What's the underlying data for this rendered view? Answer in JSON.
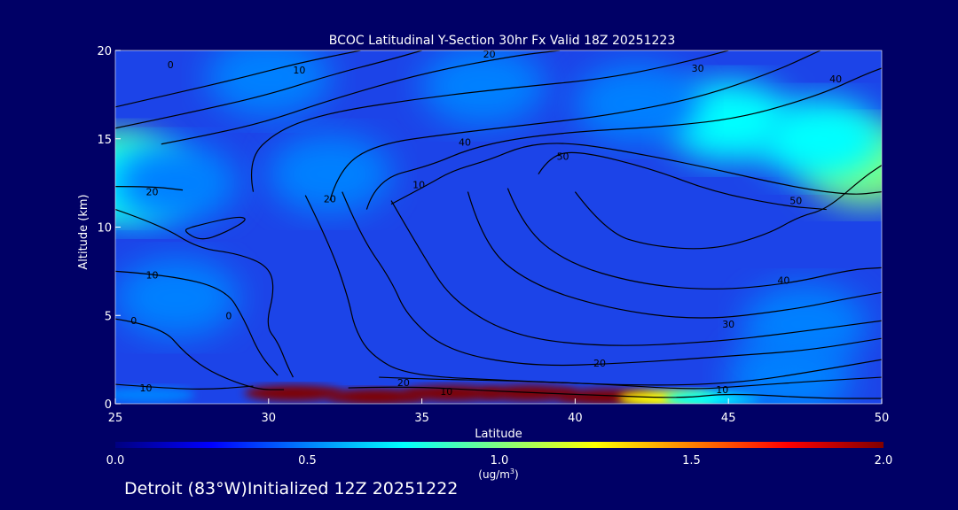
{
  "chart_data": {
    "type": "heatmap",
    "title": "BCOC Latitudinal Y-Section 30hr  Fx Valid 18Z 20251223",
    "xlabel": "Latitude",
    "ylabel": "Altitude (km)",
    "xlim": [
      25,
      50
    ],
    "ylim": [
      0,
      20
    ],
    "x_ticks": [
      "25",
      "30",
      "35",
      "40",
      "45",
      "50"
    ],
    "y_ticks": [
      "0",
      "5",
      "10",
      "15",
      "20"
    ],
    "colorbar": {
      "min": 0.0,
      "max": 2.0,
      "ticks": [
        "0.0",
        "0.5",
        "1.0",
        "1.5",
        "2.0"
      ],
      "unit_prefix": "(ug/m",
      "unit_sup": "3",
      "unit_suffix": ")",
      "colors": [
        "#000080",
        "#0000ff",
        "#0080ff",
        "#00ffff",
        "#80ff80",
        "#ffff00",
        "#ff8000",
        "#ff0000",
        "#800000"
      ]
    },
    "concentration_points": [
      {
        "lat": 25,
        "alt": 13,
        "value": 0.9
      },
      {
        "lat": 25.5,
        "alt": 12.5,
        "value": 0.75
      },
      {
        "lat": 49.5,
        "alt": 13.5,
        "value": 1.0
      },
      {
        "lat": 48,
        "alt": 15,
        "value": 0.8
      },
      {
        "lat": 45,
        "alt": 16,
        "value": 0.65
      },
      {
        "lat": 42,
        "alt": 17,
        "value": 0.5
      },
      {
        "lat": 37,
        "alt": 18,
        "value": 0.45
      },
      {
        "lat": 30,
        "alt": 18.5,
        "value": 0.45
      },
      {
        "lat": 27,
        "alt": 12.5,
        "value": 0.45
      },
      {
        "lat": 32,
        "alt": 13,
        "value": 0.4
      },
      {
        "lat": 30.8,
        "alt": 0.6,
        "value": 2.0
      },
      {
        "lat": 33.5,
        "alt": 0.4,
        "value": 1.9
      },
      {
        "lat": 36,
        "alt": 0.6,
        "value": 2.0
      },
      {
        "lat": 38.5,
        "alt": 0.6,
        "value": 2.0
      },
      {
        "lat": 41,
        "alt": 0.4,
        "value": 1.9
      },
      {
        "lat": 43,
        "alt": 0.3,
        "value": 1.2
      },
      {
        "lat": 44.5,
        "alt": 0.3,
        "value": 0.7
      },
      {
        "lat": 26,
        "alt": 0.5,
        "value": 0.5
      },
      {
        "lat": 47,
        "alt": 1.5,
        "value": 0.45
      },
      {
        "lat": 47.5,
        "alt": 4.5,
        "value": 0.45
      },
      {
        "lat": 27,
        "alt": 6,
        "value": 0.45
      }
    ],
    "contour_labels": [
      {
        "lat": 26.8,
        "alt": 19.2,
        "text": "0"
      },
      {
        "lat": 31.0,
        "alt": 18.9,
        "text": "10"
      },
      {
        "lat": 37.2,
        "alt": 19.8,
        "text": "20"
      },
      {
        "lat": 44.0,
        "alt": 19.0,
        "text": "30"
      },
      {
        "lat": 48.5,
        "alt": 18.4,
        "text": "40"
      },
      {
        "lat": 26.2,
        "alt": 12.0,
        "text": "20"
      },
      {
        "lat": 28.7,
        "alt": 5.0,
        "text": "0"
      },
      {
        "lat": 34.9,
        "alt": 12.4,
        "text": "10"
      },
      {
        "lat": 32.0,
        "alt": 11.6,
        "text": "20"
      },
      {
        "lat": 36.4,
        "alt": 14.8,
        "text": "40"
      },
      {
        "lat": 39.6,
        "alt": 14.0,
        "text": "50"
      },
      {
        "lat": 47.2,
        "alt": 11.5,
        "text": "50"
      },
      {
        "lat": 26.2,
        "alt": 7.3,
        "text": "10"
      },
      {
        "lat": 25.6,
        "alt": 4.7,
        "text": "0"
      },
      {
        "lat": 46.8,
        "alt": 7.0,
        "text": "40"
      },
      {
        "lat": 45.0,
        "alt": 4.5,
        "text": "30"
      },
      {
        "lat": 40.8,
        "alt": 2.3,
        "text": "20"
      },
      {
        "lat": 34.4,
        "alt": 1.2,
        "text": "20"
      },
      {
        "lat": 35.8,
        "alt": 0.7,
        "text": "10"
      },
      {
        "lat": 44.8,
        "alt": 0.8,
        "text": "10"
      },
      {
        "lat": 26.0,
        "alt": 0.9,
        "text": "10"
      }
    ],
    "contours": [
      [
        [
          25,
          16.8
        ],
        [
          27,
          17.6
        ],
        [
          29,
          18.4
        ],
        [
          31,
          19.3
        ],
        [
          33,
          20
        ]
      ],
      [
        [
          25,
          15.6
        ],
        [
          27.5,
          16.5
        ],
        [
          30,
          17.5
        ],
        [
          32,
          18.6
        ],
        [
          34,
          19.5
        ],
        [
          35,
          20
        ]
      ],
      [
        [
          26.5,
          14.7
        ],
        [
          28,
          15.2
        ],
        [
          30,
          16.0
        ],
        [
          32,
          17.2
        ],
        [
          35,
          18.7
        ],
        [
          38,
          19.7
        ],
        [
          39.5,
          20
        ]
      ],
      [
        [
          29.5,
          12.0
        ],
        [
          29.3,
          13.8
        ],
        [
          30.3,
          15.5
        ],
        [
          32,
          16.5
        ],
        [
          35,
          17.3
        ],
        [
          38,
          17.9
        ],
        [
          41,
          18.4
        ],
        [
          43.5,
          19.3
        ],
        [
          45,
          20
        ]
      ],
      [
        [
          32,
          11.5
        ],
        [
          32.3,
          13.3
        ],
        [
          33.5,
          14.7
        ],
        [
          36,
          15.3
        ],
        [
          38.5,
          15.8
        ],
        [
          41,
          16.3
        ],
        [
          44,
          17.3
        ],
        [
          46.5,
          18.8
        ],
        [
          48,
          20
        ]
      ],
      [
        [
          33.2,
          11.0
        ],
        [
          33.5,
          12.7
        ],
        [
          35.3,
          13.5
        ],
        [
          36.5,
          14.4
        ],
        [
          38,
          15.0
        ],
        [
          40,
          15.4
        ],
        [
          43,
          15.7
        ],
        [
          45.5,
          16.2
        ],
        [
          48,
          17.5
        ],
        [
          49.4,
          18.6
        ],
        [
          50,
          19.0
        ]
      ],
      [
        [
          34.0,
          11.3
        ],
        [
          35.2,
          12.4
        ],
        [
          36.0,
          13.2
        ],
        [
          37.2,
          13.8
        ],
        [
          38.3,
          14.6
        ],
        [
          39.5,
          14.8
        ],
        [
          41,
          14.5
        ],
        [
          44,
          13.5
        ],
        [
          47,
          12.3
        ],
        [
          49,
          11.8
        ],
        [
          50,
          12.0
        ]
      ],
      [
        [
          38.8,
          13.0
        ],
        [
          39.2,
          14.1
        ],
        [
          40.2,
          14.3
        ],
        [
          42.5,
          13.3
        ],
        [
          44.5,
          12.0
        ],
        [
          46.8,
          11.2
        ],
        [
          48.2,
          11.0
        ]
      ],
      [
        [
          40.0,
          12.0
        ],
        [
          41.0,
          9.7
        ],
        [
          42.5,
          8.9
        ],
        [
          44.5,
          8.7
        ],
        [
          46.3,
          9.6
        ],
        [
          47.3,
          10.6
        ],
        [
          48.2,
          11.0
        ],
        [
          49.4,
          12.8
        ],
        [
          50,
          13.5
        ]
      ],
      [
        [
          37.8,
          12.2
        ],
        [
          38.3,
          10.0
        ],
        [
          39.7,
          8.0
        ],
        [
          42,
          6.8
        ],
        [
          44.5,
          6.4
        ],
        [
          47,
          6.8
        ],
        [
          49,
          7.6
        ],
        [
          50,
          7.7
        ]
      ],
      [
        [
          36.5,
          12.0
        ],
        [
          37.0,
          9.0
        ],
        [
          38.5,
          6.8
        ],
        [
          41,
          5.4
        ],
        [
          44,
          4.7
        ],
        [
          47,
          5.3
        ],
        [
          49,
          6.0
        ],
        [
          50,
          6.3
        ]
      ],
      [
        [
          34.0,
          11.5
        ],
        [
          35.0,
          8.5
        ],
        [
          36.0,
          5.8
        ],
        [
          38.0,
          3.8
        ],
        [
          41.0,
          3.2
        ],
        [
          44.5,
          3.5
        ],
        [
          47,
          4.0
        ],
        [
          50,
          4.7
        ]
      ],
      [
        [
          32.4,
          12.0
        ],
        [
          33.0,
          9.5
        ],
        [
          34.0,
          7.0
        ],
        [
          34.5,
          5.0
        ],
        [
          35.8,
          3.0
        ],
        [
          38.5,
          2.1
        ],
        [
          41.8,
          2.3
        ],
        [
          45,
          2.7
        ],
        [
          47.5,
          3.0
        ],
        [
          50,
          3.7
        ]
      ],
      [
        [
          31.2,
          11.8
        ],
        [
          32.0,
          9.0
        ],
        [
          32.6,
          6.0
        ],
        [
          32.8,
          4.3
        ],
        [
          33.3,
          2.8
        ],
        [
          34.5,
          1.6
        ],
        [
          38.0,
          1.3
        ],
        [
          42.5,
          1.0
        ],
        [
          45.5,
          1.2
        ],
        [
          48,
          1.9
        ],
        [
          50,
          2.5
        ]
      ],
      [
        [
          33.6,
          1.5
        ],
        [
          35.0,
          1.4
        ],
        [
          38.0,
          1.3
        ],
        [
          41.0,
          1.1
        ],
        [
          43.8,
          0.8
        ],
        [
          45.5,
          1.0
        ],
        [
          48,
          1.3
        ],
        [
          50,
          1.5
        ]
      ],
      [
        [
          32.6,
          0.9
        ],
        [
          34.5,
          1.0
        ],
        [
          37.5,
          0.7
        ],
        [
          40.5,
          0.5
        ],
        [
          43.5,
          0.3
        ],
        [
          45,
          0.6
        ],
        [
          48,
          0.3
        ],
        [
          50,
          0.3
        ]
      ],
      [
        [
          25,
          11.0
        ],
        [
          26.5,
          10.1
        ],
        [
          27.7,
          8.8
        ],
        [
          29,
          8.5
        ],
        [
          30,
          7.8
        ],
        [
          30.2,
          6.5
        ],
        [
          29.9,
          4.4
        ],
        [
          30.3,
          3.5
        ],
        [
          30.6,
          2.2
        ],
        [
          30.8,
          1.5
        ]
      ],
      [
        [
          25,
          12.3
        ],
        [
          26.2,
          12.3
        ],
        [
          27.2,
          12.1
        ]
      ],
      [
        [
          25,
          7.5
        ],
        [
          26.7,
          7.3
        ],
        [
          28.6,
          6.5
        ],
        [
          29.2,
          4.8
        ],
        [
          29.7,
          2.8
        ],
        [
          30.3,
          1.6
        ]
      ],
      [
        [
          25,
          4.8
        ],
        [
          26.5,
          4.4
        ],
        [
          27.3,
          2.8
        ],
        [
          28.2,
          1.7
        ],
        [
          29.6,
          0.8
        ],
        [
          30.5,
          0.8
        ]
      ],
      [
        [
          25,
          1.1
        ],
        [
          26.5,
          0.9
        ],
        [
          28,
          0.8
        ],
        [
          29.5,
          1.0
        ]
      ],
      [
        [
          27.5,
          10.0
        ],
        [
          28.8,
          10.6
        ],
        [
          29.4,
          10.5
        ],
        [
          28.6,
          9.7
        ],
        [
          27.8,
          9.2
        ],
        [
          27.2,
          9.8
        ],
        [
          27.5,
          10.0
        ]
      ]
    ]
  },
  "footer": {
    "text": "Detroit (83°W)Initialized 12Z 20251222"
  }
}
